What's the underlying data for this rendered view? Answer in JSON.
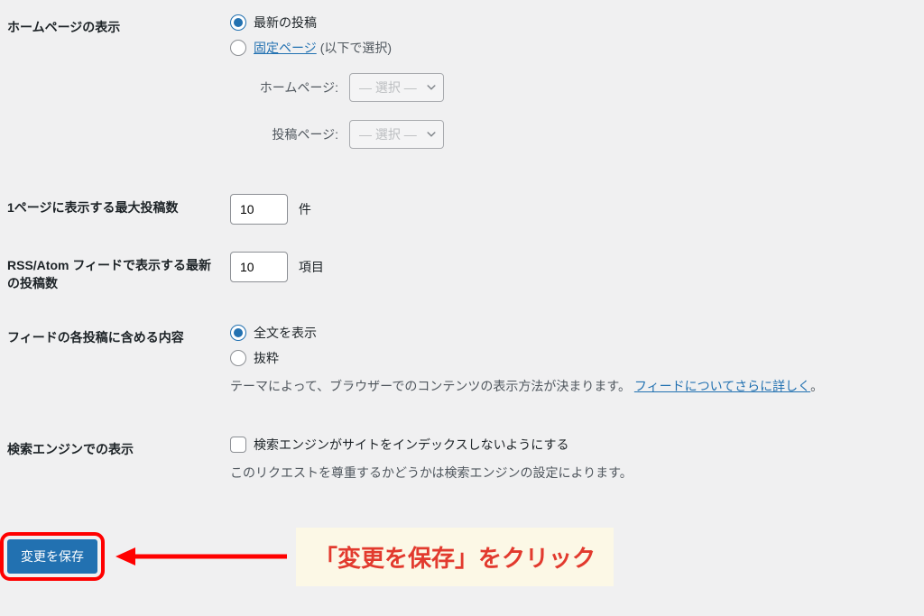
{
  "rows": {
    "homepage": {
      "label": "ホームページの表示",
      "opt_latest": "最新の投稿",
      "opt_static": "固定ページ",
      "opt_static_note": "(以下で選択)",
      "sub_home_label": "ホームページ:",
      "sub_posts_label": "投稿ページ:",
      "select_placeholder": "— 選択 —"
    },
    "posts_per_page": {
      "label": "1ページに表示する最大投稿数",
      "value": "10",
      "unit": "件"
    },
    "rss_items": {
      "label": "RSS/Atom フィードで表示する最新の投稿数",
      "value": "10",
      "unit": "項目"
    },
    "feed_content": {
      "label": "フィードの各投稿に含める内容",
      "opt_full": "全文を表示",
      "opt_excerpt": "抜粋",
      "desc_pre": "テーマによって、ブラウザーでのコンテンツの表示方法が決まります。",
      "desc_link": "フィードについてさらに詳しく",
      "desc_post": "。"
    },
    "search_engine": {
      "label": "検索エンジンでの表示",
      "checkbox_label": "検索エンジンがサイトをインデックスしないようにする",
      "desc": "このリクエストを尊重するかどうかは検索エンジンの設定によります。"
    }
  },
  "submit": {
    "button": "変更を保存"
  },
  "annotation": {
    "text": "「変更を保存」をクリック"
  }
}
